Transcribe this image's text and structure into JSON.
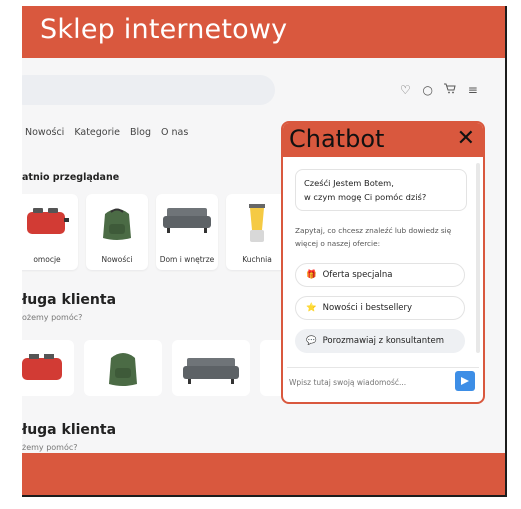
{
  "app": {
    "title": "Sklep internetowy"
  },
  "header": {
    "icons": [
      "heart-icon",
      "chat-bubble-icon",
      "cart-icon",
      "menu-icon"
    ]
  },
  "nav": {
    "items": [
      "Nowości",
      "Kategorie",
      "Blog",
      "O nas"
    ]
  },
  "recent": {
    "title": "atnio przeglądane",
    "cards": [
      {
        "label": "omocje",
        "icon": "toaster"
      },
      {
        "label": "Nowości",
        "icon": "backpack"
      },
      {
        "label": "Dom i wnętrze",
        "icon": "sofa"
      },
      {
        "label": "Kuchnia",
        "icon": "blender"
      }
    ]
  },
  "service1": {
    "title": "ługa klienta",
    "subtitle": "ożemy pomóc?"
  },
  "service2": {
    "title": "ługa klienta",
    "subtitle": "żemy pomóc?"
  },
  "chat": {
    "title": "Chatbot",
    "close_glyph": "✕",
    "greeting_line1": "Cześći  Jestem Botem,",
    "greeting_line2": "w czym mogę Ci pomóc dziś?",
    "hint": "Zapytaj, co chcesz znaleźć lub dowiedz się więcej o naszej ofercie:",
    "options": [
      {
        "label": "Oferta specjalna",
        "icon": "gift-icon",
        "glyph": "🎁"
      },
      {
        "label": "Nowości i bestsellery",
        "icon": "star-icon",
        "glyph": "⭐"
      },
      {
        "label": "Porozmawiaj z konsultantem",
        "icon": "speech-bubble-icon",
        "glyph": "💬"
      }
    ],
    "input_placeholder": "Wpisz tutaj swoją wiadomość...",
    "accent": "#d9583e",
    "send_color": "#3d8ee6"
  }
}
